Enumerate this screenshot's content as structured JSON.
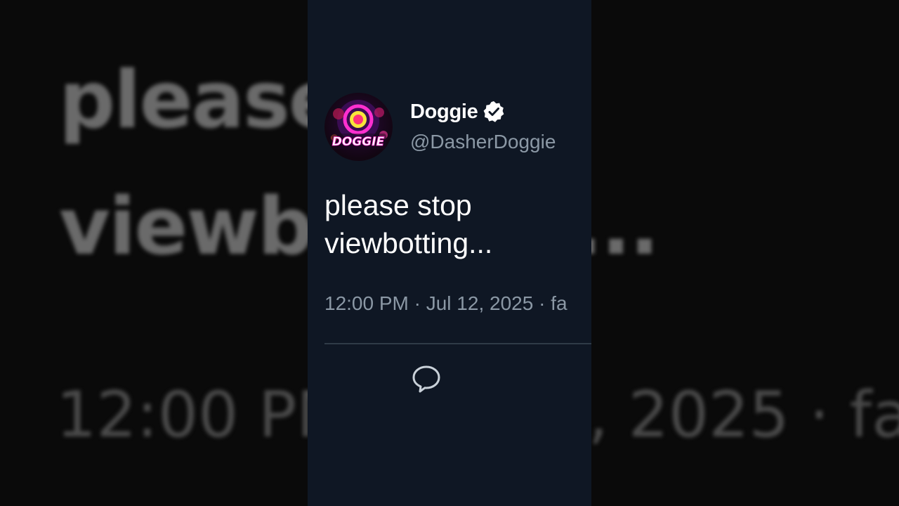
{
  "background": {
    "line1": "please stop",
    "line2": "viewbotting...",
    "line3": "12:00 PM · Jul 12, 2025 · fa"
  },
  "tweet": {
    "display_name": "Doggie",
    "handle": "@DasherDoggie",
    "verified": true,
    "avatar_text": "DOGGIE",
    "text_line1": "please stop",
    "text_line2": "viewbotting...",
    "timestamp": "12:00 PM · Jul 12, 2025 · fa",
    "actions": [
      "reply-icon"
    ]
  },
  "colors": {
    "card_background": "#0f1724",
    "primary_text": "#ffffff",
    "secondary_text": "#8b98a5",
    "divider": "#2f3b47"
  }
}
